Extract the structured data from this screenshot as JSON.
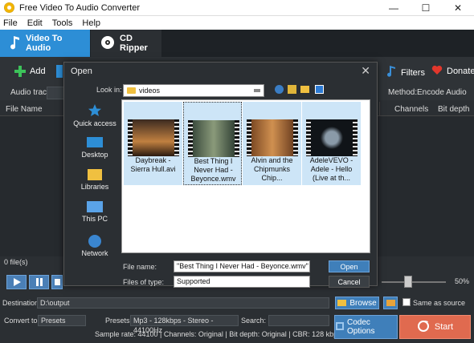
{
  "window": {
    "title": "Free Video To Audio Converter",
    "minimize": "—",
    "maximize": "☐",
    "close": "✕"
  },
  "menu": [
    "File",
    "Edit",
    "Tools",
    "Help"
  ],
  "tabs": [
    {
      "label": "Video To Audio"
    },
    {
      "label": "CD Ripper"
    }
  ],
  "toolbar": {
    "add": "Add",
    "filters": "Filters",
    "donate": "Donate"
  },
  "track": {
    "audio_track_label": "Audio track:",
    "method_label": "Method:",
    "method_value": "Encode Audio"
  },
  "list": {
    "col_file_name": "File Name",
    "col_channels": "Channels",
    "col_bit_depth": "Bit depth",
    "file_count": "0 file(s)"
  },
  "player": {
    "volume": "50%"
  },
  "bottom": {
    "destination_label": "Destination:",
    "destination_value": "D:\\output",
    "browse": "Browse",
    "same_as_source": "Same as source",
    "convert_to_label": "Convert to:",
    "convert_to_value": "Presets",
    "presets_label": "Presets:",
    "presets_value": "Mp3 - 128kbps - Stereo - 44100Hz",
    "search_label": "Search:",
    "info": "Sample rate: 44100 | Channels: Original | Bit depth: Original | CBR: 128 kbps",
    "codec_options": "Codec Options",
    "start": "Start"
  },
  "dialog": {
    "title": "Open",
    "close": "✕",
    "look_in_label": "Look in:",
    "look_in_value": "videos",
    "places": [
      "Quick access",
      "Desktop",
      "Libraries",
      "This PC",
      "Network"
    ],
    "files": [
      {
        "name": "Daybreak - Sierra Hull.avi"
      },
      {
        "name": "Best Thing I Never Had - Beyonce.wmv"
      },
      {
        "name": "Alvin and the Chipmunks Chip..."
      },
      {
        "name": "AdeleVEVO - Adele - Hello (Live at th..."
      }
    ],
    "file_name_label": "File name:",
    "file_name_value": "\"Best Thing I Never Had - Beyonce.wmv\" \"Alvi",
    "file_type_label": "Files of type:",
    "file_type_value": "Supported",
    "open_button": "Open",
    "cancel_button": "Cancel"
  }
}
